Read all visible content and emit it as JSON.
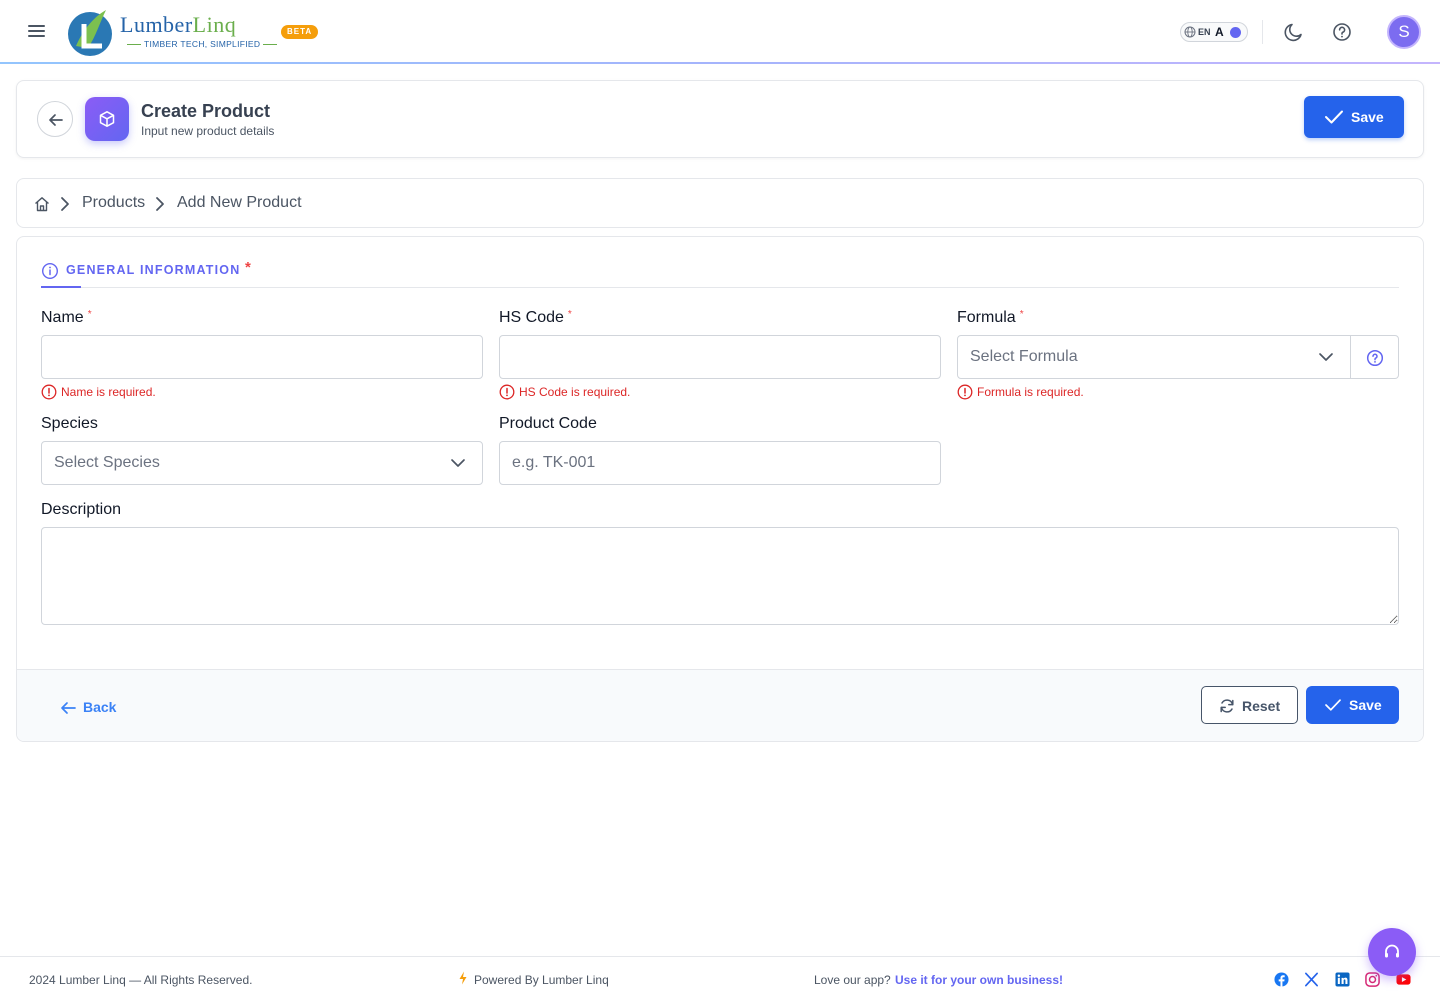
{
  "brand": {
    "name_part1": "Lumber",
    "name_part2": "Linq",
    "tagline": "TIMBER TECH, SIMPLIFIED",
    "badge": "BETA",
    "colors": {
      "blue": "#2563a8",
      "green": "#6aae4c"
    }
  },
  "topbar": {
    "lang_code": "EN",
    "lang_glyph": "A",
    "avatar_initial": "S",
    "icons": [
      "menu-icon",
      "globe-icon",
      "moon-icon",
      "help-icon"
    ]
  },
  "header": {
    "title": "Create Product",
    "subtitle": "Input new product details",
    "save_label": "Save"
  },
  "breadcrumb": {
    "items": [
      "Products",
      "Add New Product"
    ]
  },
  "form": {
    "tab_label": "GENERAL INFORMATION",
    "tab_required_mark": "*",
    "fields": {
      "name": {
        "label": "Name",
        "required": "*",
        "value": "",
        "error": "Name is required."
      },
      "hs_code": {
        "label": "HS Code",
        "required": "*",
        "value": "",
        "error": "HS Code is required."
      },
      "formula": {
        "label": "Formula",
        "required": "*",
        "placeholder": "Select Formula",
        "error": "Formula is required."
      },
      "species": {
        "label": "Species",
        "placeholder": "Select Species"
      },
      "product_code": {
        "label": "Product Code",
        "placeholder": "e.g. TK-001"
      },
      "description": {
        "label": "Description",
        "value": ""
      }
    },
    "footer": {
      "back_label": "Back",
      "reset_label": "Reset",
      "save_label": "Save"
    }
  },
  "page_footer": {
    "copyright": "2024 Lumber Linq — All Rights Reserved.",
    "powered_by": "Powered By Lumber Linq",
    "promo_text": "Love our app?",
    "promo_link": "Use it for your own business!",
    "social": [
      "facebook-icon",
      "x-icon",
      "linkedin-icon",
      "instagram-icon",
      "youtube-icon"
    ]
  },
  "colors": {
    "primary": "#2563eb",
    "accent": "#6366f1",
    "error": "#dc2626",
    "fab": "#8b5cf6"
  }
}
